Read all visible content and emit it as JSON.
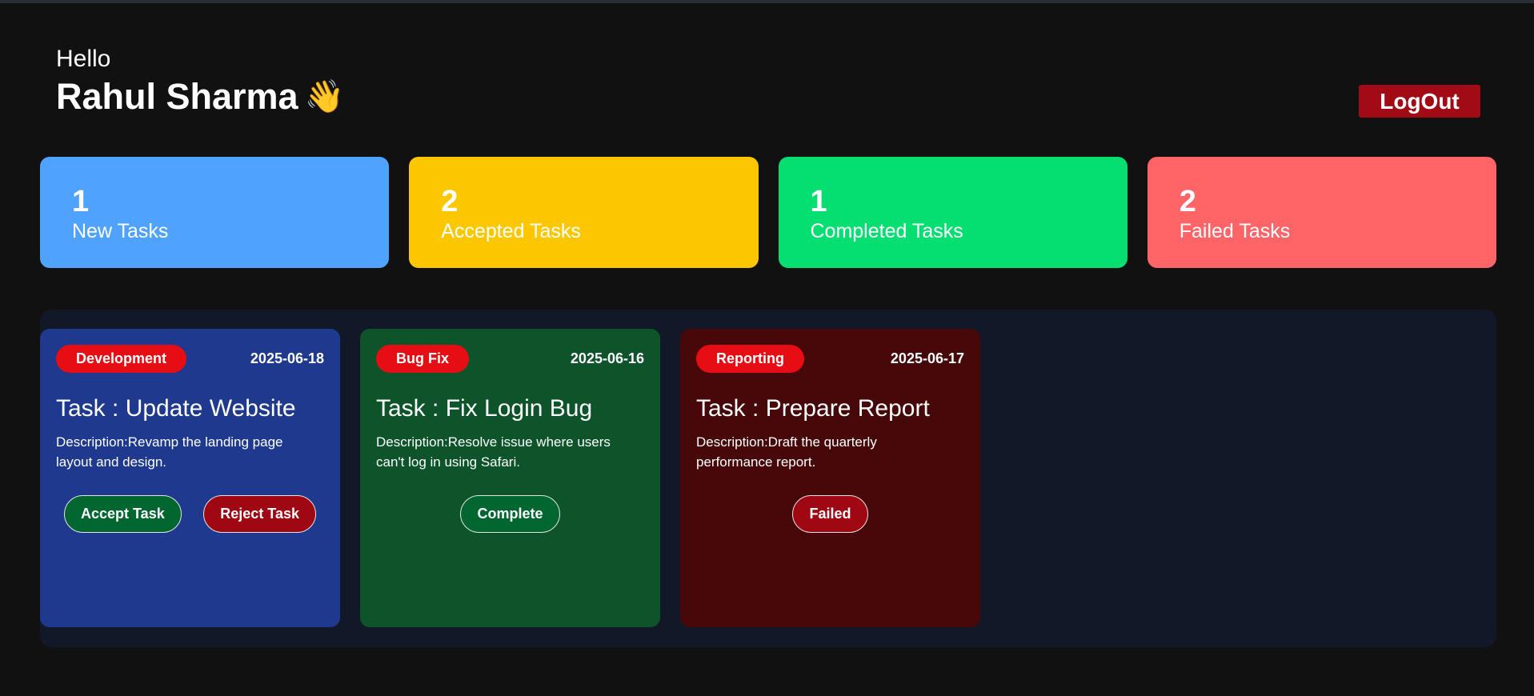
{
  "header": {
    "greeting": "Hello",
    "user_name": "Rahul Sharma",
    "wave_emoji": "👋",
    "logout_label": "LogOut"
  },
  "stats": [
    {
      "count": "1",
      "label": "New Tasks",
      "color": "#4fa3ff"
    },
    {
      "count": "2",
      "label": "Accepted Tasks",
      "color": "#fdc700"
    },
    {
      "count": "1",
      "label": "Completed Tasks",
      "color": "#05df72"
    },
    {
      "count": "2",
      "label": "Failed Tasks",
      "color": "#ff6467"
    }
  ],
  "tasks": [
    {
      "category": "Development",
      "date": "2025-06-18",
      "title": "Task : Update Website",
      "description": "Description:Revamp the landing page layout and design.",
      "card_color": "#1e398d",
      "actions": [
        "Accept Task",
        "Reject Task"
      ]
    },
    {
      "category": "Bug Fix",
      "date": "2025-06-16",
      "title": "Task : Fix Login Bug",
      "description": "Description:Resolve issue where users can't log in using Safari.",
      "card_color": "#0d542b",
      "actions": [
        "Complete"
      ]
    },
    {
      "category": "Reporting",
      "date": "2025-06-17",
      "title": "Task : Prepare Report",
      "description": "Description:Draft the quarterly performance report.",
      "card_color": "#460809",
      "actions": [
        "Failed"
      ]
    }
  ],
  "colors": {
    "accept_button": "#016630",
    "reject_button": "#9f0712",
    "complete_button": "#016630",
    "failed_button": "#9f0712",
    "logout_button": "#a10b16",
    "badge": "#e60d14"
  }
}
